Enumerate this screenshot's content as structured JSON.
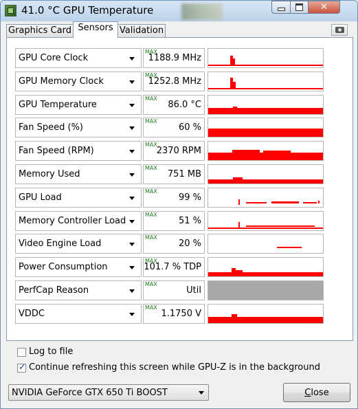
{
  "window": {
    "title": "41.0 °C GPU Temperature",
    "controls": {
      "minimize": "minimize-icon",
      "maximize": "maximize-icon",
      "close": "✕"
    }
  },
  "tabs": [
    {
      "label": "Graphics Card",
      "active": false
    },
    {
      "label": "Sensors",
      "active": true
    },
    {
      "label": "Validation",
      "active": false
    }
  ],
  "toolbar": {
    "screenshot_icon": "camera-icon"
  },
  "max_label": "MAX",
  "colors": {
    "graph_line": "#ff0000",
    "graph_fill_gray": "#a8a8a8",
    "max_tag": "#1f7a1f"
  },
  "sensors": [
    {
      "name": "GPU Core Clock",
      "value": "1188.9 MHz"
    },
    {
      "name": "GPU Memory Clock",
      "value": "1252.8 MHz"
    },
    {
      "name": "GPU Temperature",
      "value": "86.0 °C"
    },
    {
      "name": "Fan Speed (%)",
      "value": "60 %"
    },
    {
      "name": "Fan Speed (RPM)",
      "value": "2370 RPM"
    },
    {
      "name": "Memory Used",
      "value": "751 MB"
    },
    {
      "name": "GPU Load",
      "value": "99 %"
    },
    {
      "name": "Memory Controller Load",
      "value": "51 %"
    },
    {
      "name": "Video Engine Load",
      "value": "20 %"
    },
    {
      "name": "Power Consumption",
      "value": "101.7 % TDP"
    },
    {
      "name": "PerfCap Reason",
      "value": "Util"
    },
    {
      "name": "VDDC",
      "value": "1.1750 V"
    }
  ],
  "options": {
    "log_to_file": {
      "label": "Log to file",
      "checked": false
    },
    "continue_refreshing": {
      "label": "Continue refreshing this screen while GPU-Z is in the background",
      "checked": true
    }
  },
  "footer": {
    "gpu_select": "NVIDIA GeForce GTX 650 Ti BOOST",
    "close_label_underlined": "C",
    "close_label_rest": "lose"
  }
}
